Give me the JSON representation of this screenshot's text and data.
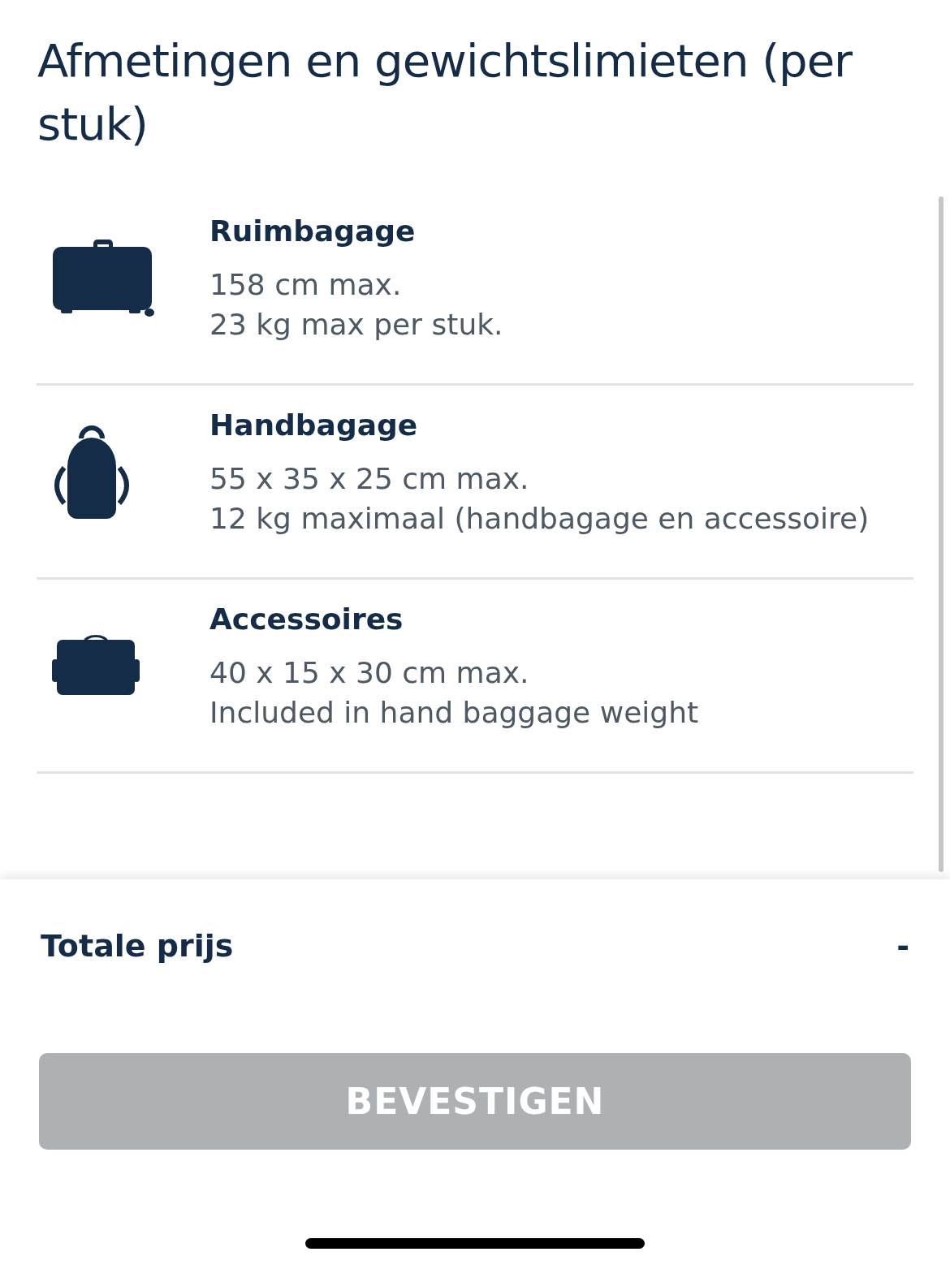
{
  "title": "Afmetingen en gewichtslimieten (per stuk)",
  "items": [
    {
      "kind": "suitcase",
      "name": "Ruimbagage",
      "lines": [
        "158 cm max.",
        "23 kg max per stuk."
      ]
    },
    {
      "kind": "backpack",
      "name": "Handbagage",
      "lines": [
        "55 x 35 x 25 cm max.",
        "12 kg maximaal (handbagage en accessoire)"
      ]
    },
    {
      "kind": "bag",
      "name": "Accessoires",
      "lines": [
        "40 x 15 x 30 cm max.",
        "Included in hand baggage weight"
      ]
    }
  ],
  "total": {
    "label": "Totale prijs",
    "value": "-"
  },
  "button": {
    "label": "BEVESTIGEN",
    "disabled": true
  }
}
